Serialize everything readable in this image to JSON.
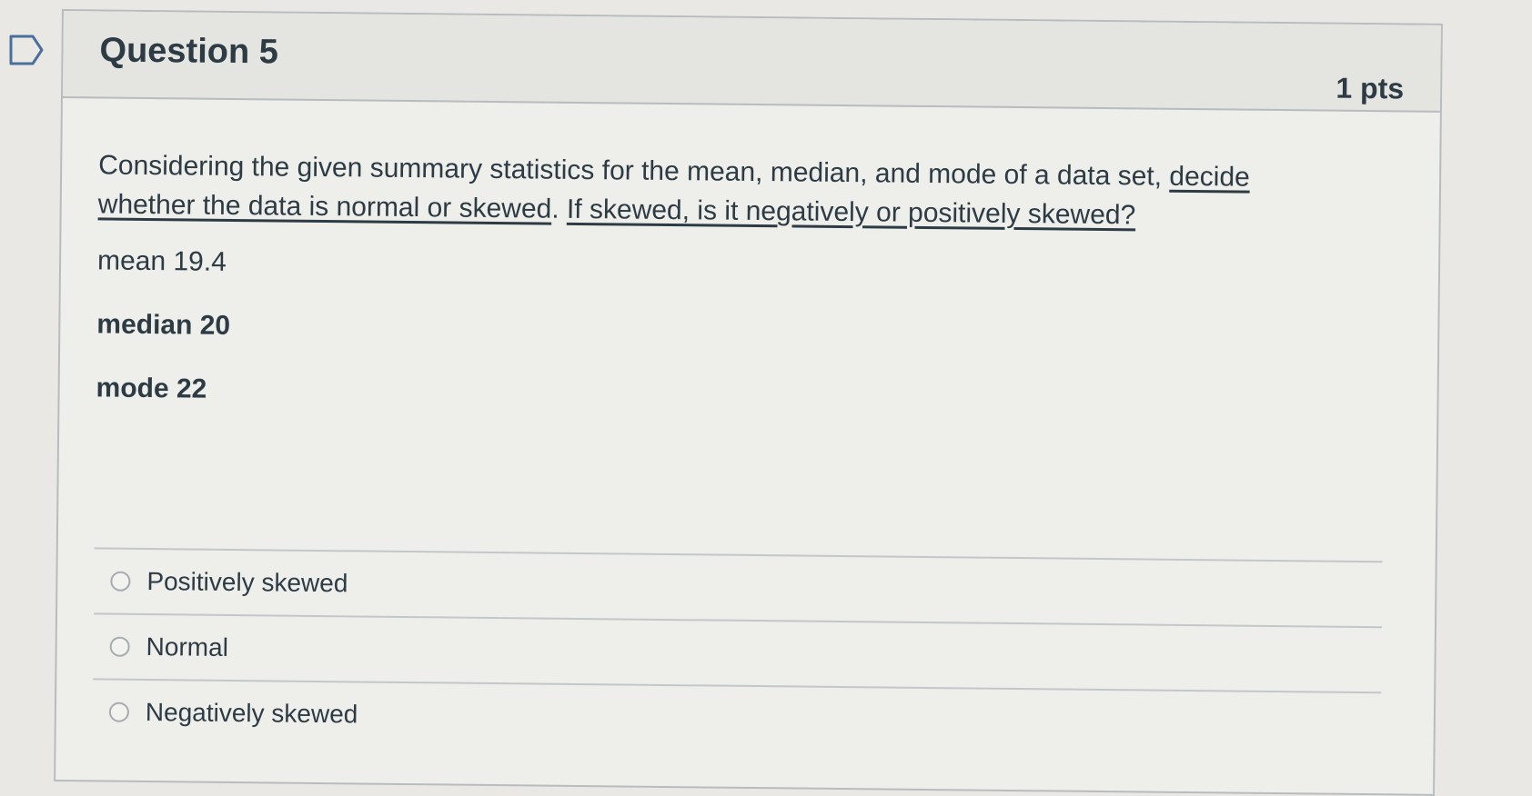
{
  "question": {
    "title": "Question 5",
    "points": "1 pts",
    "prompt": {
      "part1": "Considering the given summary statistics for the  mean, median, and mode of a data set,  ",
      "part2": "decide whether the data is normal or skewed",
      "part3": ". ",
      "part4": "If skewed, is it negatively or positively skewed?"
    },
    "stats": {
      "mean": "mean 19.4",
      "median": "median 20",
      "mode": "mode  22"
    },
    "answers": [
      {
        "label": "Positively skewed",
        "selected": false
      },
      {
        "label": "Normal",
        "selected": false
      },
      {
        "label": "Negatively skewed",
        "selected": false
      }
    ]
  },
  "icons": {
    "flag": "flag-outline-icon"
  }
}
